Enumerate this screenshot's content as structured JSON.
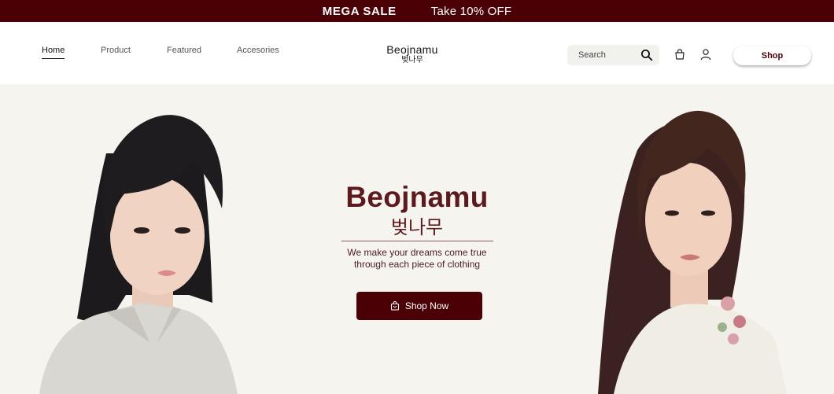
{
  "promo": {
    "sale": "MEGA SALE",
    "offer": "Take 10% OFF"
  },
  "nav": {
    "items": [
      {
        "label": "Home",
        "active": true
      },
      {
        "label": "Product",
        "active": false
      },
      {
        "label": "Featured",
        "active": false
      },
      {
        "label": "Accesories",
        "active": false
      }
    ]
  },
  "logo": {
    "en": "Beojnamu",
    "ko": "벚나무"
  },
  "search": {
    "placeholder": "Search",
    "icon": "search-icon"
  },
  "header_icons": [
    "bag-icon",
    "user-icon"
  ],
  "header": {
    "shop_label": "Shop"
  },
  "hero": {
    "title": "Beojnamu",
    "title_ko": "벚나무",
    "tagline_line1": "We make your dreams come true",
    "tagline_line2": "through each piece of clothing",
    "cta_label": "Shop Now",
    "cta_icon": "shopping-bag-icon"
  },
  "colors": {
    "accent": "#4a0005",
    "title": "#5c1a1e",
    "hero_bg": "#f6f4ef",
    "search_bg": "#f1f1ee"
  }
}
